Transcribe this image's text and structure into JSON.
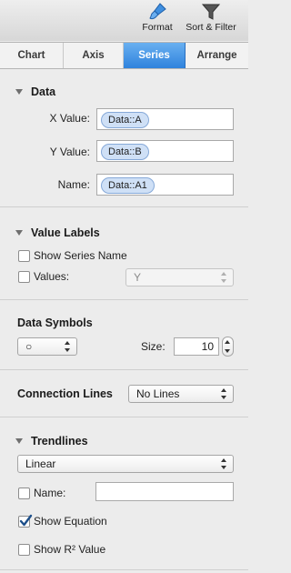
{
  "toolbar": {
    "format_label": "Format",
    "filter_label": "Sort & Filter"
  },
  "tabs": [
    {
      "label": "Chart",
      "active": false
    },
    {
      "label": "Axis",
      "active": false
    },
    {
      "label": "Series",
      "active": true
    },
    {
      "label": "Arrange",
      "active": false
    }
  ],
  "data_section": {
    "title": "Data",
    "x_value_label": "X Value:",
    "x_value_token": "Data::A",
    "y_value_label": "Y Value:",
    "y_value_token": "Data::B",
    "name_label": "Name:",
    "name_token": "Data::A1"
  },
  "value_labels": {
    "title": "Value Labels",
    "show_series_name_label": "Show Series Name",
    "show_series_name_checked": false,
    "values_label": "Values:",
    "values_checked": false,
    "values_select": "Y"
  },
  "data_symbols": {
    "title": "Data Symbols",
    "symbol_select": "○",
    "size_label": "Size:",
    "size_value": "10"
  },
  "connection_lines": {
    "title": "Connection Lines",
    "select": "No Lines"
  },
  "trendlines": {
    "title": "Trendlines",
    "type_select": "Linear",
    "name_label": "Name:",
    "name_checked": false,
    "name_value": "",
    "show_equation_label": "Show Equation",
    "show_equation_checked": true,
    "show_r2_label": "Show R² Value",
    "show_r2_checked": false
  },
  "colors": {
    "active_tab": "#2f82dd",
    "token_bg": "#cfe0f6",
    "panel_bg": "#ececec"
  }
}
